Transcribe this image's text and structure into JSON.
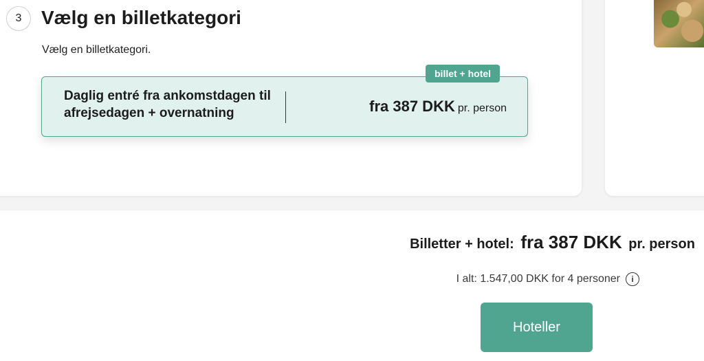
{
  "step": {
    "number": "3",
    "title": "Vælg en billetkategori",
    "subtitle": "Vælg en billetkategori."
  },
  "option": {
    "badge": "billet + hotel",
    "description": "Daglig entré fra ankomstdagen til afrejsedagen + overnatning",
    "price": "fra 387 DKK",
    "unit": "pr. person"
  },
  "summary": {
    "label": "Billetter + hotel:",
    "price": "fra 387 DKK",
    "unit": "pr. person",
    "total": "I alt: 1.547,00 DKK for 4 personer",
    "info_icon": "info-icon"
  },
  "button": {
    "hotels_label": "Hoteller"
  },
  "colors": {
    "accent": "#4fa58f",
    "option_bg": "#e1f1ee"
  }
}
